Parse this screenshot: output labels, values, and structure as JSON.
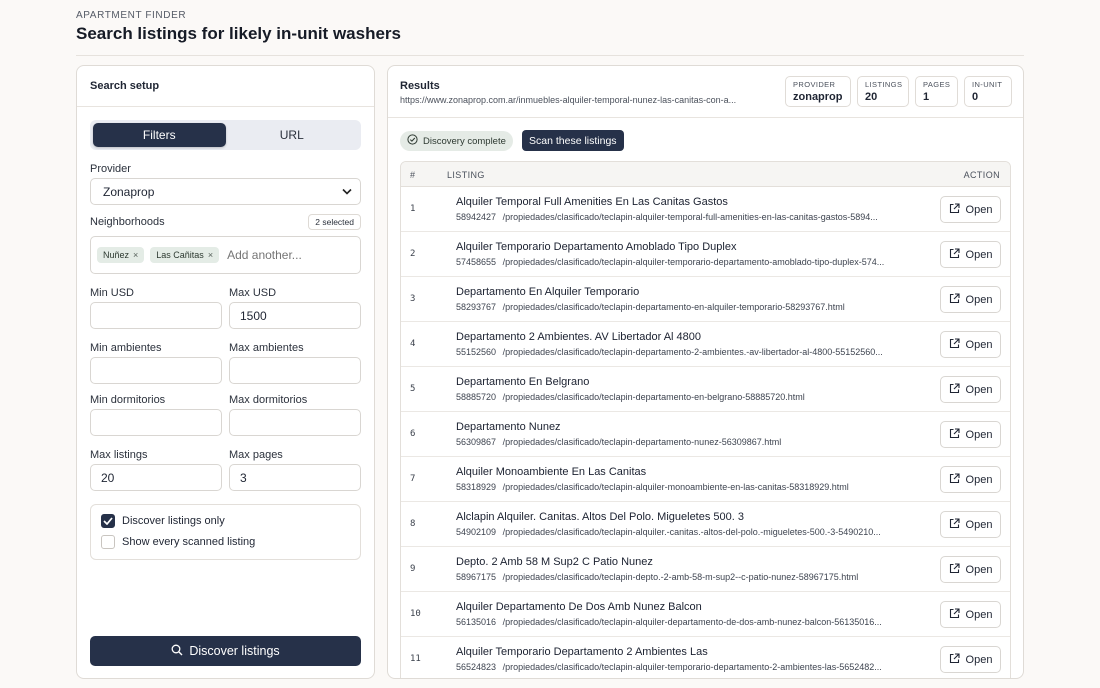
{
  "header": {
    "eyebrow": "APARTMENT FINDER",
    "title": "Search listings for likely in-unit washers"
  },
  "setup": {
    "title": "Search setup",
    "tabs": [
      "Filters",
      "URL"
    ],
    "provider_label": "Provider",
    "provider_value": "Zonaprop",
    "neighborhoods_label": "Neighborhoods",
    "selected_badge": "2 selected",
    "chips": [
      "Nuñez",
      "Las Cañitas"
    ],
    "chip_placeholder": "Add another...",
    "min_usd_label": "Min USD",
    "min_usd": "",
    "max_usd_label": "Max USD",
    "max_usd": "1500",
    "min_amb_label": "Min ambientes",
    "min_amb": "",
    "max_amb_label": "Max ambientes",
    "max_amb": "",
    "min_dorm_label": "Min dormitorios",
    "min_dorm": "",
    "max_dorm_label": "Max dormitorios",
    "max_dorm": "",
    "max_listings_label": "Max listings",
    "max_listings": "20",
    "max_pages_label": "Max pages",
    "max_pages": "3",
    "check_discover": "Discover listings only",
    "check_show": "Show every scanned listing",
    "discover_button": "Discover listings"
  },
  "results": {
    "title": "Results",
    "url": "https://www.zonaprop.com.ar/inmuebles-alquiler-temporal-nunez-las-canitas-con-a...",
    "stats": [
      {
        "k": "PROVIDER",
        "v": "zonaprop"
      },
      {
        "k": "LISTINGS",
        "v": "20"
      },
      {
        "k": "PAGES",
        "v": "1"
      },
      {
        "k": "IN-UNIT",
        "v": "0"
      }
    ],
    "status_tag": "Discovery complete",
    "scan_button": "Scan these listings",
    "columns": [
      "#",
      "LISTING",
      "ACTION"
    ],
    "open_label": "Open",
    "rows": [
      {
        "n": "1",
        "title": "Alquiler Temporal Full Amenities En Las Canitas Gastos",
        "id": "58942427",
        "path": "/propiedades/clasificado/teclapin-alquiler-temporal-full-amenities-en-las-canitas-gastos-5894..."
      },
      {
        "n": "2",
        "title": "Alquiler Temporario Departamento Amoblado Tipo Duplex",
        "id": "57458655",
        "path": "/propiedades/clasificado/teclapin-alquiler-temporario-departamento-amoblado-tipo-duplex-574..."
      },
      {
        "n": "3",
        "title": "Departamento En Alquiler Temporario",
        "id": "58293767",
        "path": "/propiedades/clasificado/teclapin-departamento-en-alquiler-temporario-58293767.html"
      },
      {
        "n": "4",
        "title": "Departamento 2 Ambientes. AV Libertador Al 4800",
        "id": "55152560",
        "path": "/propiedades/clasificado/teclapin-departamento-2-ambientes.-av-libertador-al-4800-55152560..."
      },
      {
        "n": "5",
        "title": "Departamento En Belgrano",
        "id": "58885720",
        "path": "/propiedades/clasificado/teclapin-departamento-en-belgrano-58885720.html"
      },
      {
        "n": "6",
        "title": "Departamento Nunez",
        "id": "56309867",
        "path": "/propiedades/clasificado/teclapin-departamento-nunez-56309867.html"
      },
      {
        "n": "7",
        "title": "Alquiler Monoambiente En Las Canitas",
        "id": "58318929",
        "path": "/propiedades/clasificado/teclapin-alquiler-monoambiente-en-las-canitas-58318929.html"
      },
      {
        "n": "8",
        "title": "Alclapin Alquiler. Canitas. Altos Del Polo. Migueletes 500. 3",
        "id": "54902109",
        "path": "/propiedades/clasificado/teclapin-alquiler.-canitas.-altos-del-polo.-migueletes-500.-3-5490210..."
      },
      {
        "n": "9",
        "title": "Depto. 2 Amb 58 M Sup2 C Patio Nunez",
        "id": "58967175",
        "path": "/propiedades/clasificado/teclapin-depto.-2-amb-58-m-sup2--c-patio-nunez-58967175.html"
      },
      {
        "n": "10",
        "title": "Alquiler Departamento De Dos Amb Nunez Balcon",
        "id": "56135016",
        "path": "/propiedades/clasificado/teclapin-alquiler-departamento-de-dos-amb-nunez-balcon-56135016..."
      },
      {
        "n": "11",
        "title": "Alquiler Temporario Departamento 2 Ambientes Las",
        "id": "56524823",
        "path": "/propiedades/clasificado/teclapin-alquiler-temporario-departamento-2-ambientes-las-5652482..."
      }
    ]
  }
}
